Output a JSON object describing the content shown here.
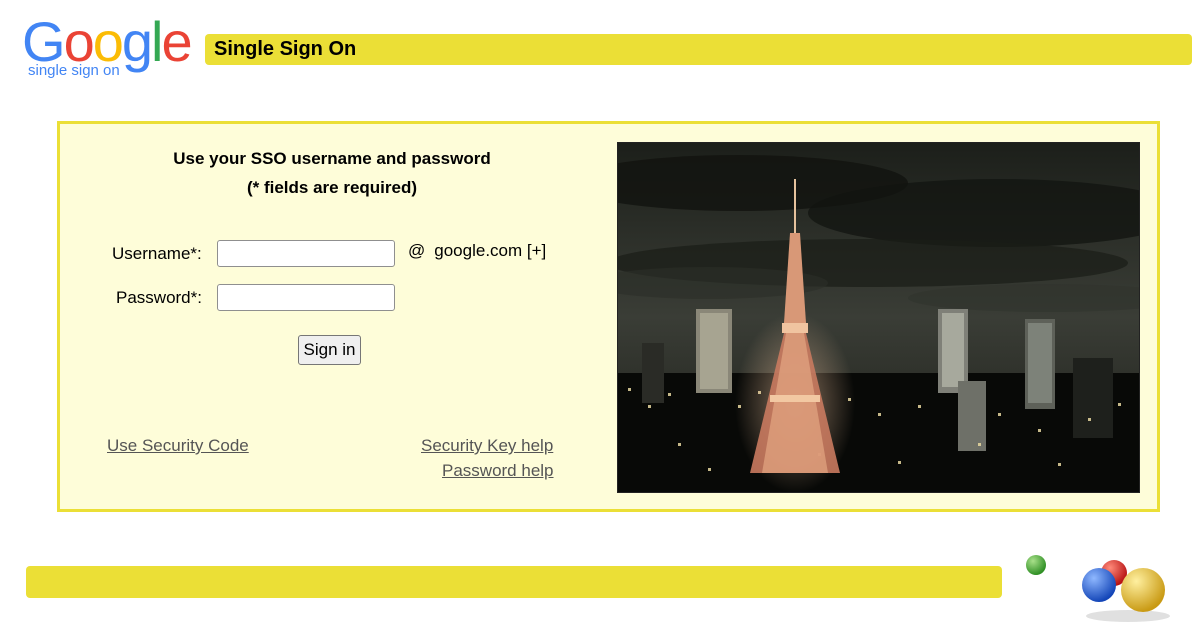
{
  "header": {
    "logo_letters": [
      {
        "ch": "G",
        "color": "#4285f4"
      },
      {
        "ch": "o",
        "color": "#ea4335"
      },
      {
        "ch": "o",
        "color": "#fbbc05"
      },
      {
        "ch": "g",
        "color": "#4285f4"
      },
      {
        "ch": "l",
        "color": "#34a853"
      },
      {
        "ch": "e",
        "color": "#ea4335"
      }
    ],
    "logo_subtitle": "single sign on",
    "title": "Single Sign On"
  },
  "login": {
    "heading": "Use your SSO username and password",
    "subheading": "(* fields are required)",
    "username_label": "Username*:",
    "username_value": "",
    "password_label": "Password*:",
    "password_value": "",
    "at_symbol": "@",
    "domain": "google.com [+]",
    "sign_in_label": "Sign in"
  },
  "links": {
    "security_code": "Use Security Code",
    "security_key_help": "Security Key help",
    "password_help": "Password help"
  },
  "colors": {
    "accent_yellow": "#ebdf36",
    "panel_bg": "#fefdd9",
    "link": "#555555"
  },
  "icons": {
    "decorative_balls": "colored-balls-icon",
    "photo": "tokyo-tower-night-photo"
  }
}
